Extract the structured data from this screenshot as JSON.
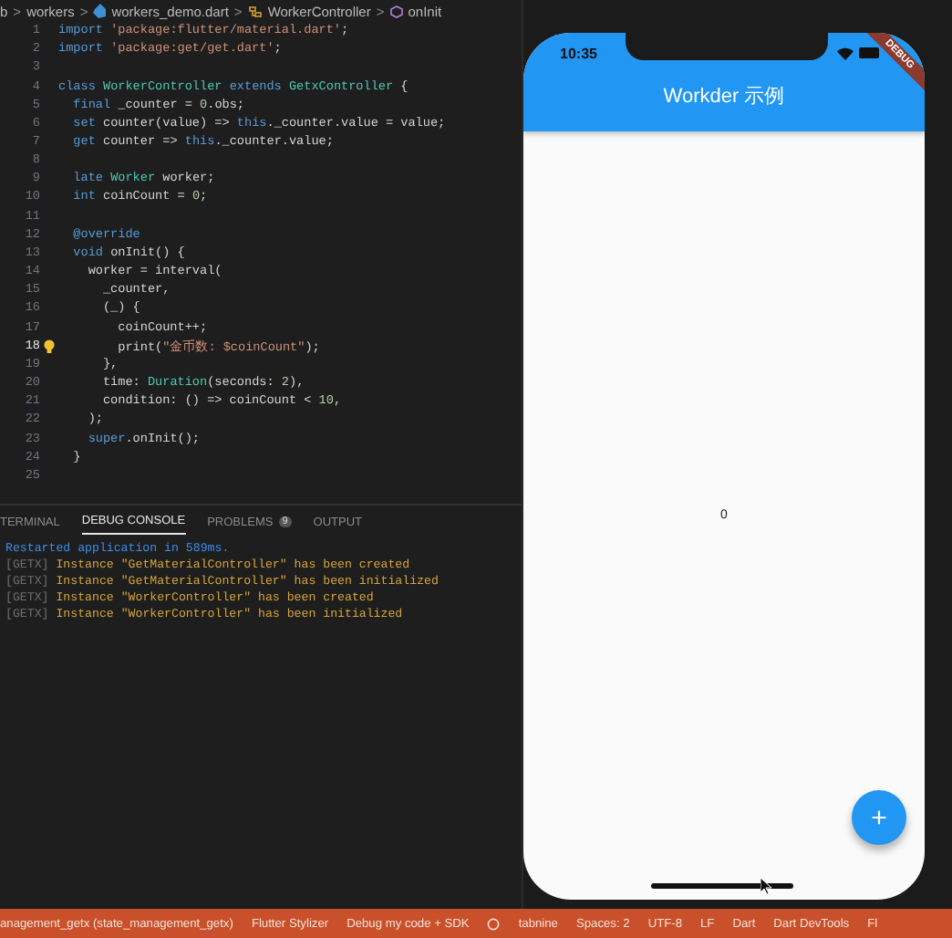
{
  "breadcrumb": [
    {
      "label": "b"
    },
    {
      "separator": ">",
      "label": "workers"
    },
    {
      "separator": ">",
      "label": "workers_demo.dart"
    },
    {
      "separator": ">",
      "label": "WorkerController"
    },
    {
      "separator": ">",
      "label": "onInit"
    }
  ],
  "code_lines": [
    {
      "number": "1",
      "active": false,
      "tokens": [
        {
          "text": "import ",
          "kind": "kw"
        },
        {
          "text": "'package:flutter/material.dart'",
          "kind": "str"
        },
        {
          "text": ";",
          "kind": "plain"
        }
      ]
    },
    {
      "number": "2",
      "active": false,
      "tokens": [
        {
          "text": "import ",
          "kind": "kw"
        },
        {
          "text": "'package:get/get.dart'",
          "kind": "str"
        },
        {
          "text": ";",
          "kind": "plain"
        }
      ]
    },
    {
      "number": "3",
      "active": false
    },
    {
      "number": "4",
      "active": false,
      "tokens": [
        {
          "text": "class ",
          "kind": "kw"
        },
        {
          "text": "WorkerController ",
          "kind": "type"
        },
        {
          "text": "extends ",
          "kind": "kw"
        },
        {
          "text": "GetxController ",
          "kind": "type"
        },
        {
          "text": "{",
          "kind": "plain"
        }
      ]
    },
    {
      "number": "5",
      "active": false,
      "tokens": [
        {
          "text": "  final ",
          "kind": "kw"
        },
        {
          "text": "_counter = ",
          "kind": "plain"
        },
        {
          "text": "0",
          "kind": "num"
        },
        {
          "text": ".obs;",
          "kind": "plain"
        }
      ]
    },
    {
      "number": "6",
      "active": false,
      "tokens": [
        {
          "text": "  set ",
          "kind": "kw"
        },
        {
          "text": "counter(value) => ",
          "kind": "plain"
        },
        {
          "text": "this",
          "kind": "kw"
        },
        {
          "text": "._counter.value = value;",
          "kind": "plain"
        }
      ]
    },
    {
      "number": "7",
      "active": false,
      "tokens": [
        {
          "text": "  get ",
          "kind": "kw"
        },
        {
          "text": "counter => ",
          "kind": "plain"
        },
        {
          "text": "this",
          "kind": "kw"
        },
        {
          "text": "._counter.value;",
          "kind": "plain"
        }
      ]
    },
    {
      "number": "8",
      "active": false
    },
    {
      "number": "9",
      "active": false,
      "tokens": [
        {
          "text": "  late ",
          "kind": "kw"
        },
        {
          "text": "Worker ",
          "kind": "type"
        },
        {
          "text": "worker;",
          "kind": "plain"
        }
      ]
    },
    {
      "number": "10",
      "active": false,
      "tokens": [
        {
          "text": "  int ",
          "kind": "kw"
        },
        {
          "text": "coinCount = ",
          "kind": "plain"
        },
        {
          "text": "0",
          "kind": "num"
        },
        {
          "text": ";",
          "kind": "plain"
        }
      ]
    },
    {
      "number": "11",
      "active": false
    },
    {
      "number": "12",
      "active": false,
      "tokens": [
        {
          "text": "  @override",
          "kind": "kw"
        }
      ]
    },
    {
      "number": "13",
      "active": false,
      "tokens": [
        {
          "text": "  void ",
          "kind": "kw"
        },
        {
          "text": "onInit() {",
          "kind": "plain"
        }
      ]
    },
    {
      "number": "14",
      "active": false,
      "tokens": [
        {
          "text": "    worker = interval(",
          "kind": "plain"
        }
      ]
    },
    {
      "number": "15",
      "active": false,
      "tokens": [
        {
          "text": "      _counter,",
          "kind": "plain"
        }
      ]
    },
    {
      "number": "16",
      "active": false,
      "tokens": [
        {
          "text": "      (_) {",
          "kind": "plain"
        }
      ]
    },
    {
      "number": "17",
      "active": false,
      "tokens": [
        {
          "text": "        coinCount++;",
          "kind": "plain"
        }
      ]
    },
    {
      "number": "18",
      "active": true,
      "tokens": [
        {
          "text": "        print(",
          "kind": "plain"
        },
        {
          "text": "\"金币数: $coinCount\"",
          "kind": "str"
        },
        {
          "text": ");",
          "kind": "plain"
        }
      ]
    },
    {
      "number": "19",
      "active": false,
      "tokens": [
        {
          "text": "      },",
          "kind": "plain"
        }
      ]
    },
    {
      "number": "20",
      "active": false,
      "tokens": [
        {
          "text": "      time: ",
          "kind": "plain"
        },
        {
          "text": "Duration",
          "kind": "type"
        },
        {
          "text": "(seconds: ",
          "kind": "plain"
        },
        {
          "text": "2",
          "kind": "num"
        },
        {
          "text": "),",
          "kind": "plain"
        }
      ]
    },
    {
      "number": "21",
      "active": false,
      "tokens": [
        {
          "text": "      condition: () => coinCount < ",
          "kind": "plain"
        },
        {
          "text": "10",
          "kind": "num"
        },
        {
          "text": ",",
          "kind": "plain"
        }
      ]
    },
    {
      "number": "22",
      "active": false,
      "tokens": [
        {
          "text": "    );",
          "kind": "plain"
        }
      ]
    },
    {
      "number": "23",
      "active": false,
      "tokens": [
        {
          "text": "    super",
          "kind": "kw"
        },
        {
          "text": ".onInit();",
          "kind": "plain"
        }
      ]
    },
    {
      "number": "24",
      "active": false,
      "tokens": [
        {
          "text": "  }",
          "kind": "plain"
        }
      ]
    },
    {
      "number": "25",
      "active": false
    }
  ],
  "panel_tabs": [
    {
      "label": "TERMINAL",
      "selected": false
    },
    {
      "label": "DEBUG CONSOLE",
      "selected": true
    },
    {
      "label": "PROBLEMS",
      "selected": false,
      "badge": "9"
    },
    {
      "label": "OUTPUT",
      "selected": false
    }
  ],
  "console_lines": [
    {
      "kind": "info",
      "message": "Restarted application in 589ms."
    },
    {
      "kind": "getx",
      "prefix": "[GETX]",
      "message": "Instance \"GetMaterialController\" has been created"
    },
    {
      "kind": "getx",
      "prefix": "[GETX]",
      "message": "Instance \"GetMaterialController\" has been initialized"
    },
    {
      "kind": "getx",
      "prefix": "[GETX]",
      "message": "Instance \"WorkerController\" has been created"
    },
    {
      "kind": "getx",
      "prefix": "[GETX]",
      "message": "Instance \"WorkerController\" has been initialized"
    }
  ],
  "phone": {
    "time": "10:35",
    "debug_banner": "DEBUG",
    "app_bar_title": "Workder 示例",
    "counter": "0",
    "fab_label": "+"
  },
  "status_bar": [
    "anagement_getx (state_management_getx)",
    "Flutter Stylizer",
    "Debug my code + SDK",
    "tabnine",
    "Spaces: 2",
    "UTF-8",
    "LF",
    "Dart",
    "Dart DevTools",
    "Fl"
  ]
}
